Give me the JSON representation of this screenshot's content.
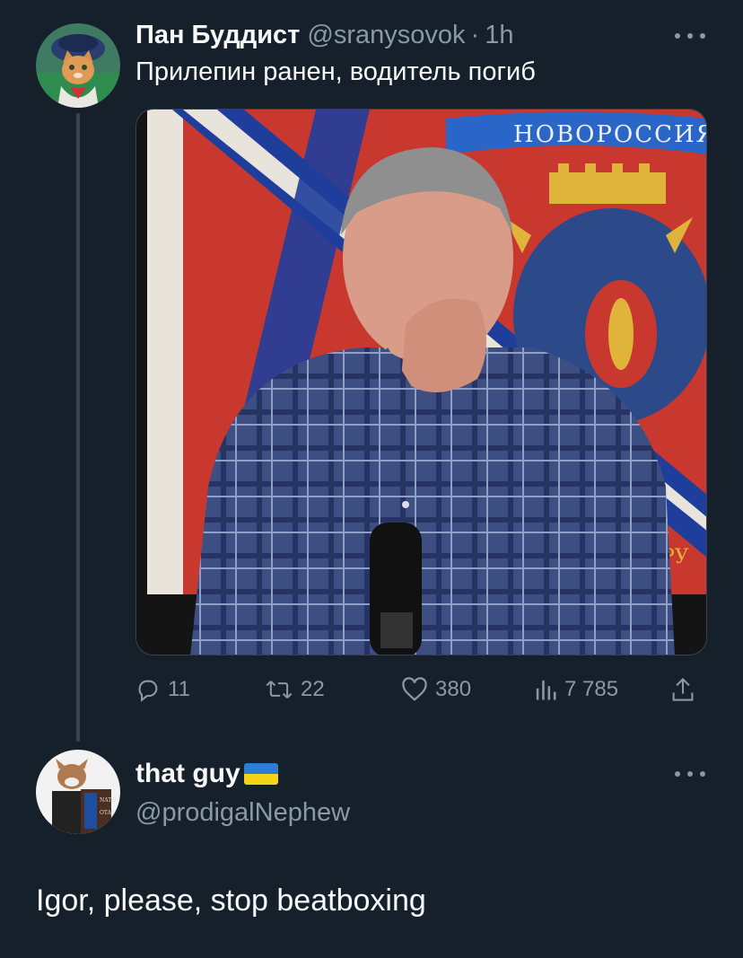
{
  "tweet": {
    "display_name": "Пан Буддист",
    "handle": "@sranysovok",
    "dot": "·",
    "time": "1h",
    "text": "Прилепин ранен, водитель погиб",
    "media": {
      "banner_text": "НОВОРОССИЯ",
      "corner_text": "РУ"
    },
    "actions": {
      "replies": "11",
      "retweets": "22",
      "likes": "380",
      "views": "7 785"
    },
    "icons": [
      "reply-icon",
      "retweet-icon",
      "like-icon",
      "views-icon",
      "share-icon",
      "more-icon"
    ]
  },
  "reply": {
    "display_name": "that guy",
    "flag": "ukraine-flag",
    "handle": "@prodigalNephew",
    "text": "Igor, please, stop beatboxing",
    "avatar_podium_text": [
      "NATO",
      "OTAN"
    ]
  },
  "colors": {
    "background": "#15202b",
    "text": "#f7f9f9",
    "muted": "#8b98a5",
    "divider": "#38444d"
  }
}
